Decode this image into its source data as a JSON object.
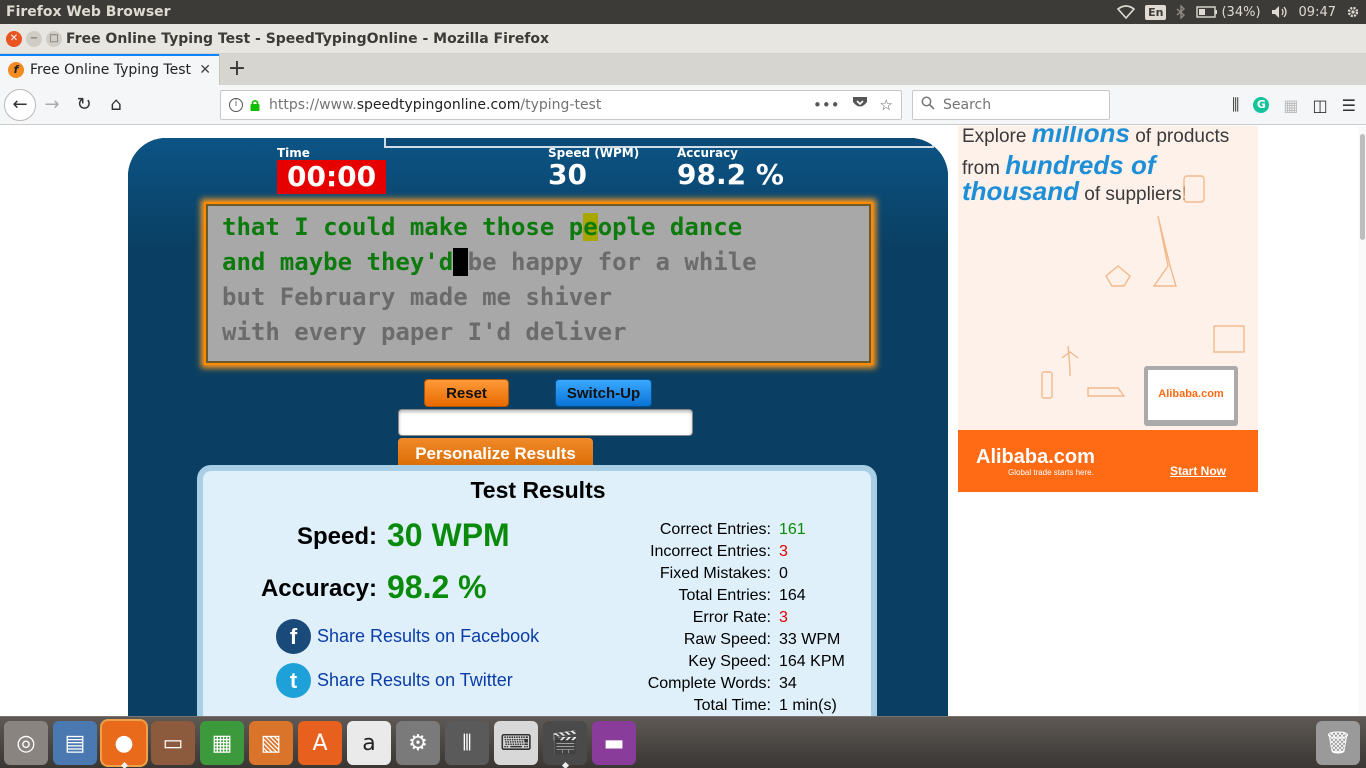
{
  "system": {
    "app_name": "Firefox Web Browser",
    "keyboard_lang": "En",
    "battery": "(34%)",
    "time": "09:47"
  },
  "window": {
    "title": "Free Online Typing Test - SpeedTypingOnline - Mozilla Firefox"
  },
  "browser": {
    "tab_title": "Free Online Typing Test",
    "url_prefix": "https://www.",
    "url_domain": "speedtypingonline.com",
    "url_path": "/typing-test",
    "search_placeholder": "Search"
  },
  "test": {
    "time_label": "Time",
    "time_value": "00:00",
    "speed_label": "Speed (WPM)",
    "speed_value": "30",
    "accuracy_label": "Accuracy",
    "accuracy_value": "98.2 %",
    "lines": [
      {
        "typed": "that I could make those p",
        "hl": "e",
        "rest_typed": "ople dance",
        "pending": ""
      },
      {
        "typed": "and maybe they'd",
        "caret": " ",
        "pending": "be happy for a while"
      },
      {
        "typed": "",
        "pending": "but February made me shiver"
      },
      {
        "typed": "",
        "pending": "with every paper I'd deliver"
      }
    ],
    "reset_label": "Reset",
    "switch_label": "Switch-Up",
    "personalize_label": "Personalize Results"
  },
  "results": {
    "heading": "Test Results",
    "speed_label": "Speed:",
    "speed_value": "30 WPM",
    "accuracy_label": "Accuracy:",
    "accuracy_value": "98.2 %",
    "share_facebook": "Share Results on Facebook",
    "share_twitter": "Share Results on Twitter",
    "details": [
      {
        "label": "Correct Entries:",
        "value": "161",
        "color": "green"
      },
      {
        "label": "Incorrect Entries:",
        "value": "3",
        "color": "red"
      },
      {
        "label": "Fixed Mistakes:",
        "value": "0",
        "color": ""
      },
      {
        "label": "Total Entries:",
        "value": "164",
        "color": ""
      },
      {
        "label": "Error Rate:",
        "value": "3",
        "color": "red"
      },
      {
        "label": "Raw Speed:",
        "value": "33 WPM",
        "color": ""
      },
      {
        "label": "Key Speed:",
        "value": "164 KPM",
        "color": ""
      },
      {
        "label": "Complete Words:",
        "value": "34",
        "color": ""
      },
      {
        "label": "Total Time:",
        "value": "1 min(s)",
        "color": ""
      }
    ]
  },
  "ad": {
    "line1_a": "Explore ",
    "line1_b": "millions",
    "line1_c": " of products",
    "line2_a": "from ",
    "line2_b": "hundreds of",
    "line3_b": "thousand",
    "line3_c": " of suppliers!",
    "laptop_logo": "Alibaba.com",
    "footer_logo": "Alibaba.com",
    "footer_tag": "Global trade starts here.",
    "cta": "Start Now"
  },
  "colors": {
    "panel": "#0a3f63",
    "typed_text": "#0c7a0c",
    "pending_text": "#6b6b6b",
    "highlight": "#a8a600",
    "timer_bg": "#e60000",
    "accent_orange": "#ff6a14",
    "link": "#0a3ca8"
  },
  "launcher_icons": [
    "dash-icon",
    "document-viewer-icon",
    "firefox-icon",
    "files-icon",
    "spreadsheet-icon",
    "presentation-icon",
    "software-center-icon",
    "amazon-icon",
    "settings-icon",
    "mixer-icon",
    "keyboard-icon",
    "video-editor-icon",
    "workspace-icon",
    "trash-icon"
  ]
}
